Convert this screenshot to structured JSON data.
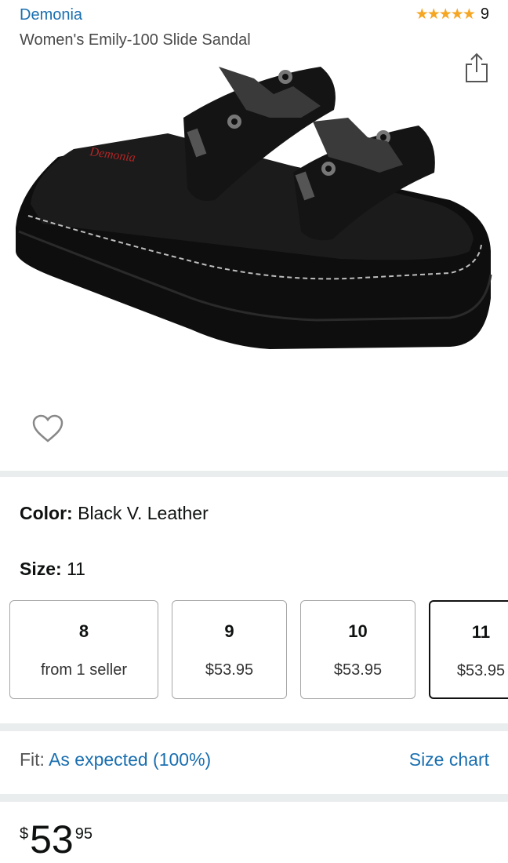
{
  "header": {
    "brand": "Demonia",
    "rating_stars": "★★★★★",
    "rating_count": "9",
    "title": "Women's Emily-100 Slide Sandal"
  },
  "product_image": {
    "alt": "Black platform slide sandal with bat buckles",
    "logo_text": "Demonia"
  },
  "color": {
    "label": "Color:",
    "value": "Black V. Leather"
  },
  "size": {
    "label": "Size:",
    "value": "11",
    "options": [
      {
        "size": "8",
        "price": "from 1 seller"
      },
      {
        "size": "9",
        "price": "$53.95"
      },
      {
        "size": "10",
        "price": "$53.95"
      },
      {
        "size": "11",
        "price": "$53.95",
        "selected": true
      }
    ]
  },
  "fit": {
    "label": "Fit:",
    "value": "As expected (100%)",
    "size_chart": "Size chart"
  },
  "price": {
    "currency": "$",
    "whole": "53",
    "fraction": "95"
  },
  "colors": {
    "link": "#1a6fb0",
    "star": "#f5a623",
    "divider": "#eaeded"
  }
}
